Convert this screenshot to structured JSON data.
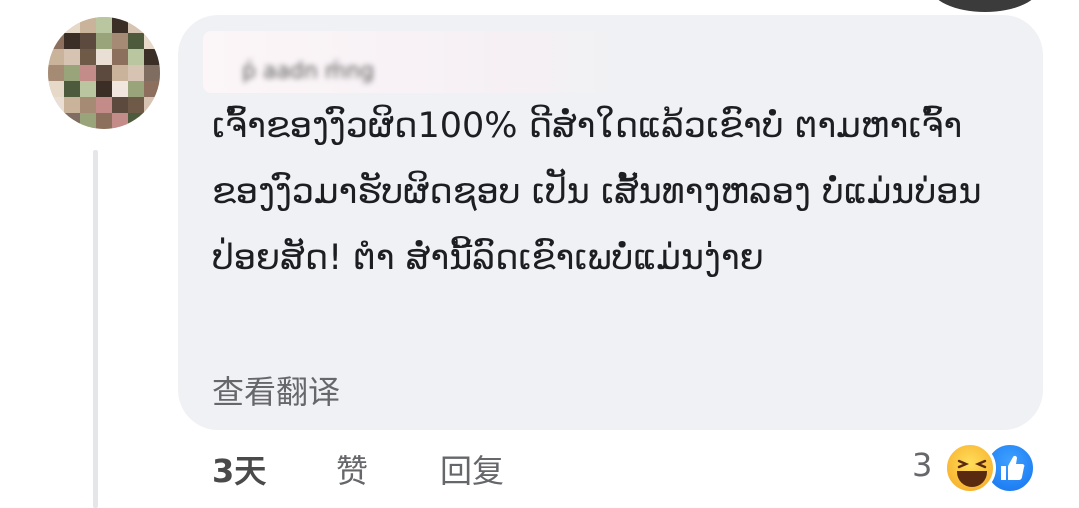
{
  "comment": {
    "author_name": "ṕ aadn ḿng",
    "text": "ເຈົ້າຂອງງົວຜິດ100% ດີສໍ່າໃດແລ້ວເຂົາບໍ່ ຕາມຫາເຈົ້າຂອງງົວມາຮັບຜິດຊອບ ເປັນ ເສັ້ນທາງຫລອງ ບໍ່ແມ່ນບ່ອນປ່ອຍສັດ! ຕຳ ສໍ່ານີ້ລົດເຂົາເພບໍ່ແມ່ນງ່າຍ",
    "translate_label": "查看翻译"
  },
  "actions": {
    "time": "3天",
    "like_label": "赞",
    "reply_label": "回复"
  },
  "reactions": {
    "count": "3",
    "icons": [
      "haha-icon",
      "like-icon"
    ]
  },
  "colors": {
    "bubble": "#f0f1f4",
    "text": "#1c1e21",
    "muted": "#65676b",
    "like_blue": "#1877f2",
    "haha_yellow": "#f7b125"
  }
}
